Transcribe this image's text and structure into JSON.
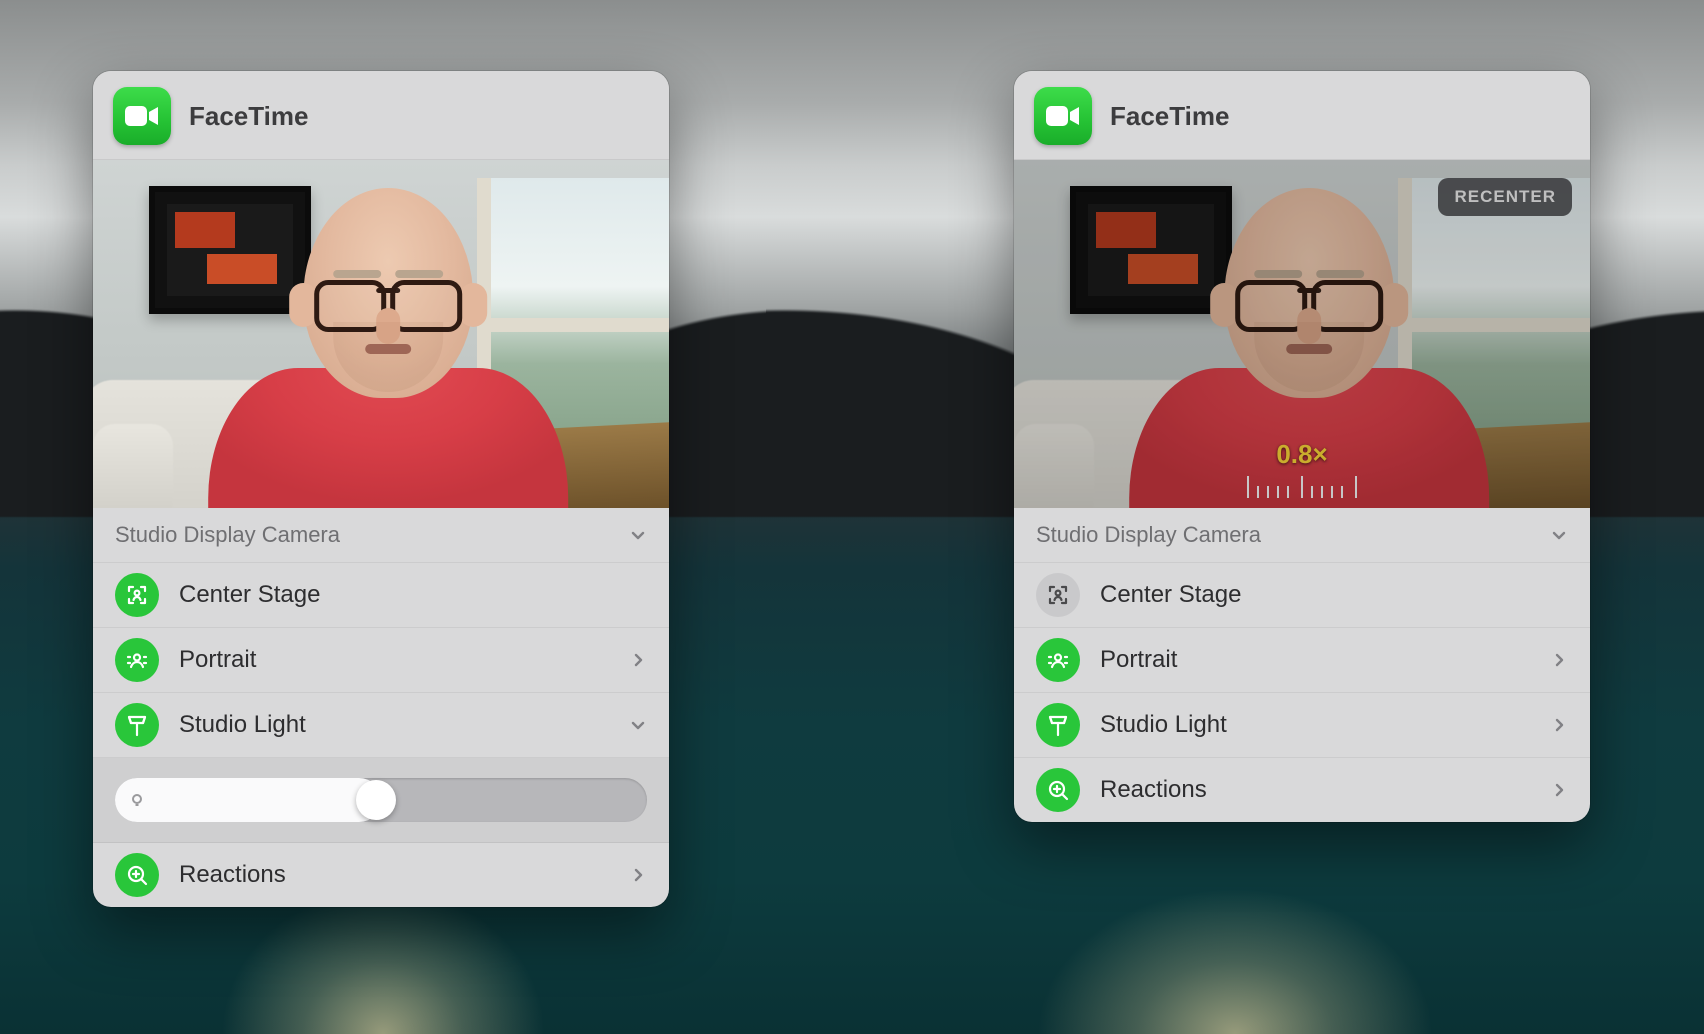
{
  "left_panel": {
    "app_title": "FaceTime",
    "camera_label": "Studio Display Camera",
    "rows": {
      "center_stage": "Center Stage",
      "portrait": "Portrait",
      "studio_light": "Studio Light",
      "reactions": "Reactions"
    },
    "center_stage_enabled": true,
    "slider_percent": 49
  },
  "right_panel": {
    "app_title": "FaceTime",
    "camera_label": "Studio Display Camera",
    "recenter_label": "RECENTER",
    "zoom_value": "0.8×",
    "rows": {
      "center_stage": "Center Stage",
      "portrait": "Portrait",
      "studio_light": "Studio Light",
      "reactions": "Reactions"
    },
    "center_stage_enabled": false
  }
}
